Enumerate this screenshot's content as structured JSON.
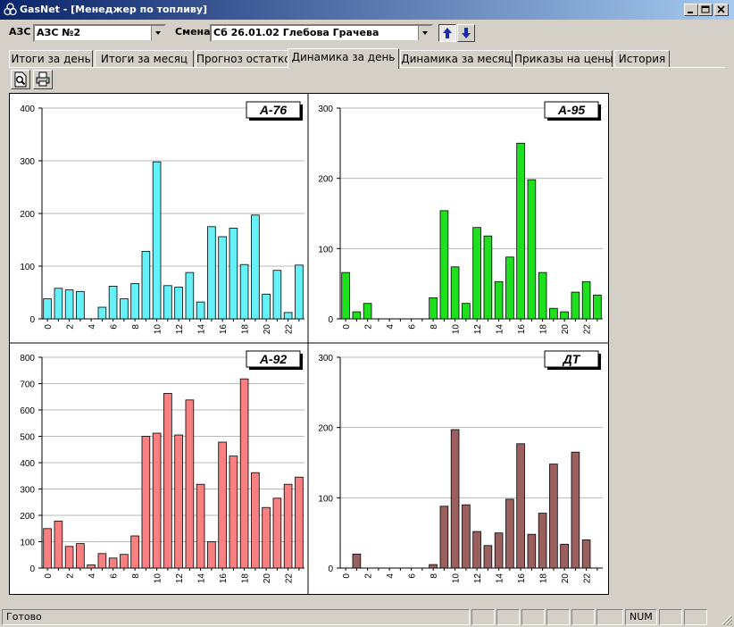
{
  "window": {
    "title": "GasNet - [Менеджер по топливу]"
  },
  "toolbar": {
    "station_label": "АЗС",
    "station_value": "АЗС №2",
    "shift_label": "Смена",
    "shift_value": "Сб 26.01.02 Глебова Грачева"
  },
  "tabs": [
    {
      "label": "Итоги за день"
    },
    {
      "label": "Итоги за месяц"
    },
    {
      "label": "Прогноз остатков"
    },
    {
      "label": "Динамика за день",
      "active": true
    },
    {
      "label": "Динамика за месяц"
    },
    {
      "label": "Приказы на цены"
    },
    {
      "label": "История"
    }
  ],
  "icons": {
    "preview": "print-preview-icon",
    "print": "printer-icon"
  },
  "chart_data": [
    {
      "type": "bar",
      "title": "А-76",
      "x": [
        0,
        1,
        2,
        3,
        4,
        5,
        6,
        7,
        8,
        9,
        10,
        11,
        12,
        13,
        14,
        15,
        16,
        17,
        18,
        19,
        20,
        21,
        22,
        23
      ],
      "xticks": [
        "0",
        "2",
        "4",
        "6",
        "8",
        "10",
        "12",
        "14",
        "16",
        "18",
        "20",
        "22"
      ],
      "ylim": [
        0,
        400
      ],
      "yticks": [
        0,
        100,
        200,
        300,
        400
      ],
      "color": "#66f0f8",
      "values": [
        38,
        58,
        55,
        52,
        0,
        22,
        62,
        38,
        67,
        128,
        298,
        63,
        60,
        88,
        32,
        175,
        156,
        172,
        103,
        197,
        47,
        92,
        12,
        102
      ]
    },
    {
      "type": "bar",
      "title": "А-95",
      "x": [
        0,
        1,
        2,
        3,
        4,
        5,
        6,
        7,
        8,
        9,
        10,
        11,
        12,
        13,
        14,
        15,
        16,
        17,
        18,
        19,
        20,
        21,
        22,
        23
      ],
      "xticks": [
        "0",
        "2",
        "4",
        "6",
        "8",
        "10",
        "12",
        "14",
        "16",
        "18",
        "20",
        "22"
      ],
      "ylim": [
        0,
        300
      ],
      "yticks": [
        0,
        100,
        200,
        300
      ],
      "color": "#1ee01e",
      "values": [
        66,
        10,
        22,
        0,
        0,
        0,
        0,
        0,
        30,
        154,
        74,
        22,
        130,
        118,
        53,
        88,
        250,
        198,
        66,
        15,
        10,
        38,
        53,
        34
      ]
    },
    {
      "type": "bar",
      "title": "А-92",
      "x": [
        0,
        1,
        2,
        3,
        4,
        5,
        6,
        7,
        8,
        9,
        10,
        11,
        12,
        13,
        14,
        15,
        16,
        17,
        18,
        19,
        20,
        21,
        22,
        23
      ],
      "xticks": [
        "0",
        "2",
        "4",
        "6",
        "8",
        "10",
        "12",
        "14",
        "16",
        "18",
        "20",
        "22"
      ],
      "ylim": [
        0,
        800
      ],
      "yticks": [
        0,
        100,
        200,
        300,
        400,
        500,
        600,
        700,
        800
      ],
      "color": "#f88080",
      "values": [
        150,
        178,
        82,
        93,
        12,
        55,
        38,
        52,
        122,
        500,
        512,
        663,
        505,
        638,
        318,
        100,
        478,
        425,
        718,
        362,
        230,
        265,
        318,
        345
      ]
    },
    {
      "type": "bar",
      "title": "ДТ",
      "x": [
        0,
        1,
        2,
        3,
        4,
        5,
        6,
        7,
        8,
        9,
        10,
        11,
        12,
        13,
        14,
        15,
        16,
        17,
        18,
        19,
        20,
        21,
        22,
        23
      ],
      "xticks": [
        "0",
        "2",
        "4",
        "6",
        "8",
        "10",
        "12",
        "14",
        "16",
        "18",
        "20",
        "22"
      ],
      "ylim": [
        0,
        300
      ],
      "yticks": [
        0,
        100,
        200,
        300
      ],
      "color": "#9a6060",
      "values": [
        0,
        20,
        0,
        0,
        0,
        0,
        0,
        0,
        5,
        88,
        197,
        90,
        52,
        32,
        50,
        98,
        177,
        48,
        78,
        148,
        34,
        165,
        40,
        0
      ]
    }
  ],
  "statusbar": {
    "text": "Готово",
    "num": "NUM"
  }
}
